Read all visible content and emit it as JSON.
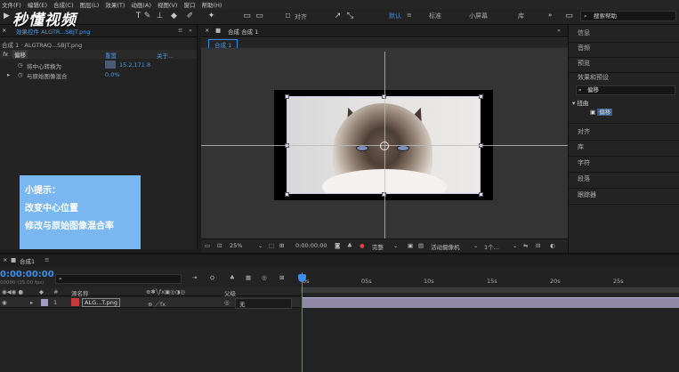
{
  "menu": [
    "文件(F)",
    "编辑(E)",
    "合成(C)",
    "图层(L)",
    "效果(T)",
    "动画(A)",
    "视图(V)",
    "窗口",
    "帮助(H)"
  ],
  "watermark": "秒懂视频",
  "toolbar": {
    "align_label": "对齐",
    "workspaces": [
      "默认",
      "标准",
      "小屏幕",
      "库"
    ],
    "more": "»",
    "search_help": "搜索帮助"
  },
  "effects_panel": {
    "tab_title": "效果控件 ALGTR...SBJT.png",
    "layer_line": "合成 1 · ALGTRAQ...SBJT.png",
    "effect_name": "偏移",
    "reset": "重置",
    "about": "关于...",
    "props": [
      {
        "name": "将中心转换为",
        "value": "15.2,171.8"
      },
      {
        "name": "与原始图像混合",
        "value": "0.0%"
      }
    ]
  },
  "tip": {
    "title": "小提示：",
    "line1": "改变中心位置",
    "line2": "修改与原始图像混合率"
  },
  "comp_panel": {
    "tab_title": "合成 合成 1",
    "sub_tab": "合成 1",
    "zoom": "25%",
    "timecode": "0:00:00:00",
    "quality": "完整",
    "camera": "活动摄像机",
    "views": "1个..."
  },
  "right_panel": {
    "items": [
      "信息",
      "音频",
      "预览",
      "效果和预设"
    ],
    "search_value": "偏移",
    "tree_folder": "扭曲",
    "tree_item": "偏移",
    "items2": [
      "对齐",
      "库",
      "字符",
      "段落",
      "跟踪器"
    ]
  },
  "timeline": {
    "tab": "合成1",
    "timecode": "0:00:00:00",
    "fps": "00000 (25.00 fps)",
    "search_placeholder": "",
    "ticks": [
      "0s",
      "05s",
      "10s",
      "15s",
      "20s",
      "25s"
    ],
    "col_source": "源名称",
    "col_parent": "父级",
    "layer_num": "1",
    "layer_name": "ALG...T.png",
    "layer_parent": "无"
  }
}
